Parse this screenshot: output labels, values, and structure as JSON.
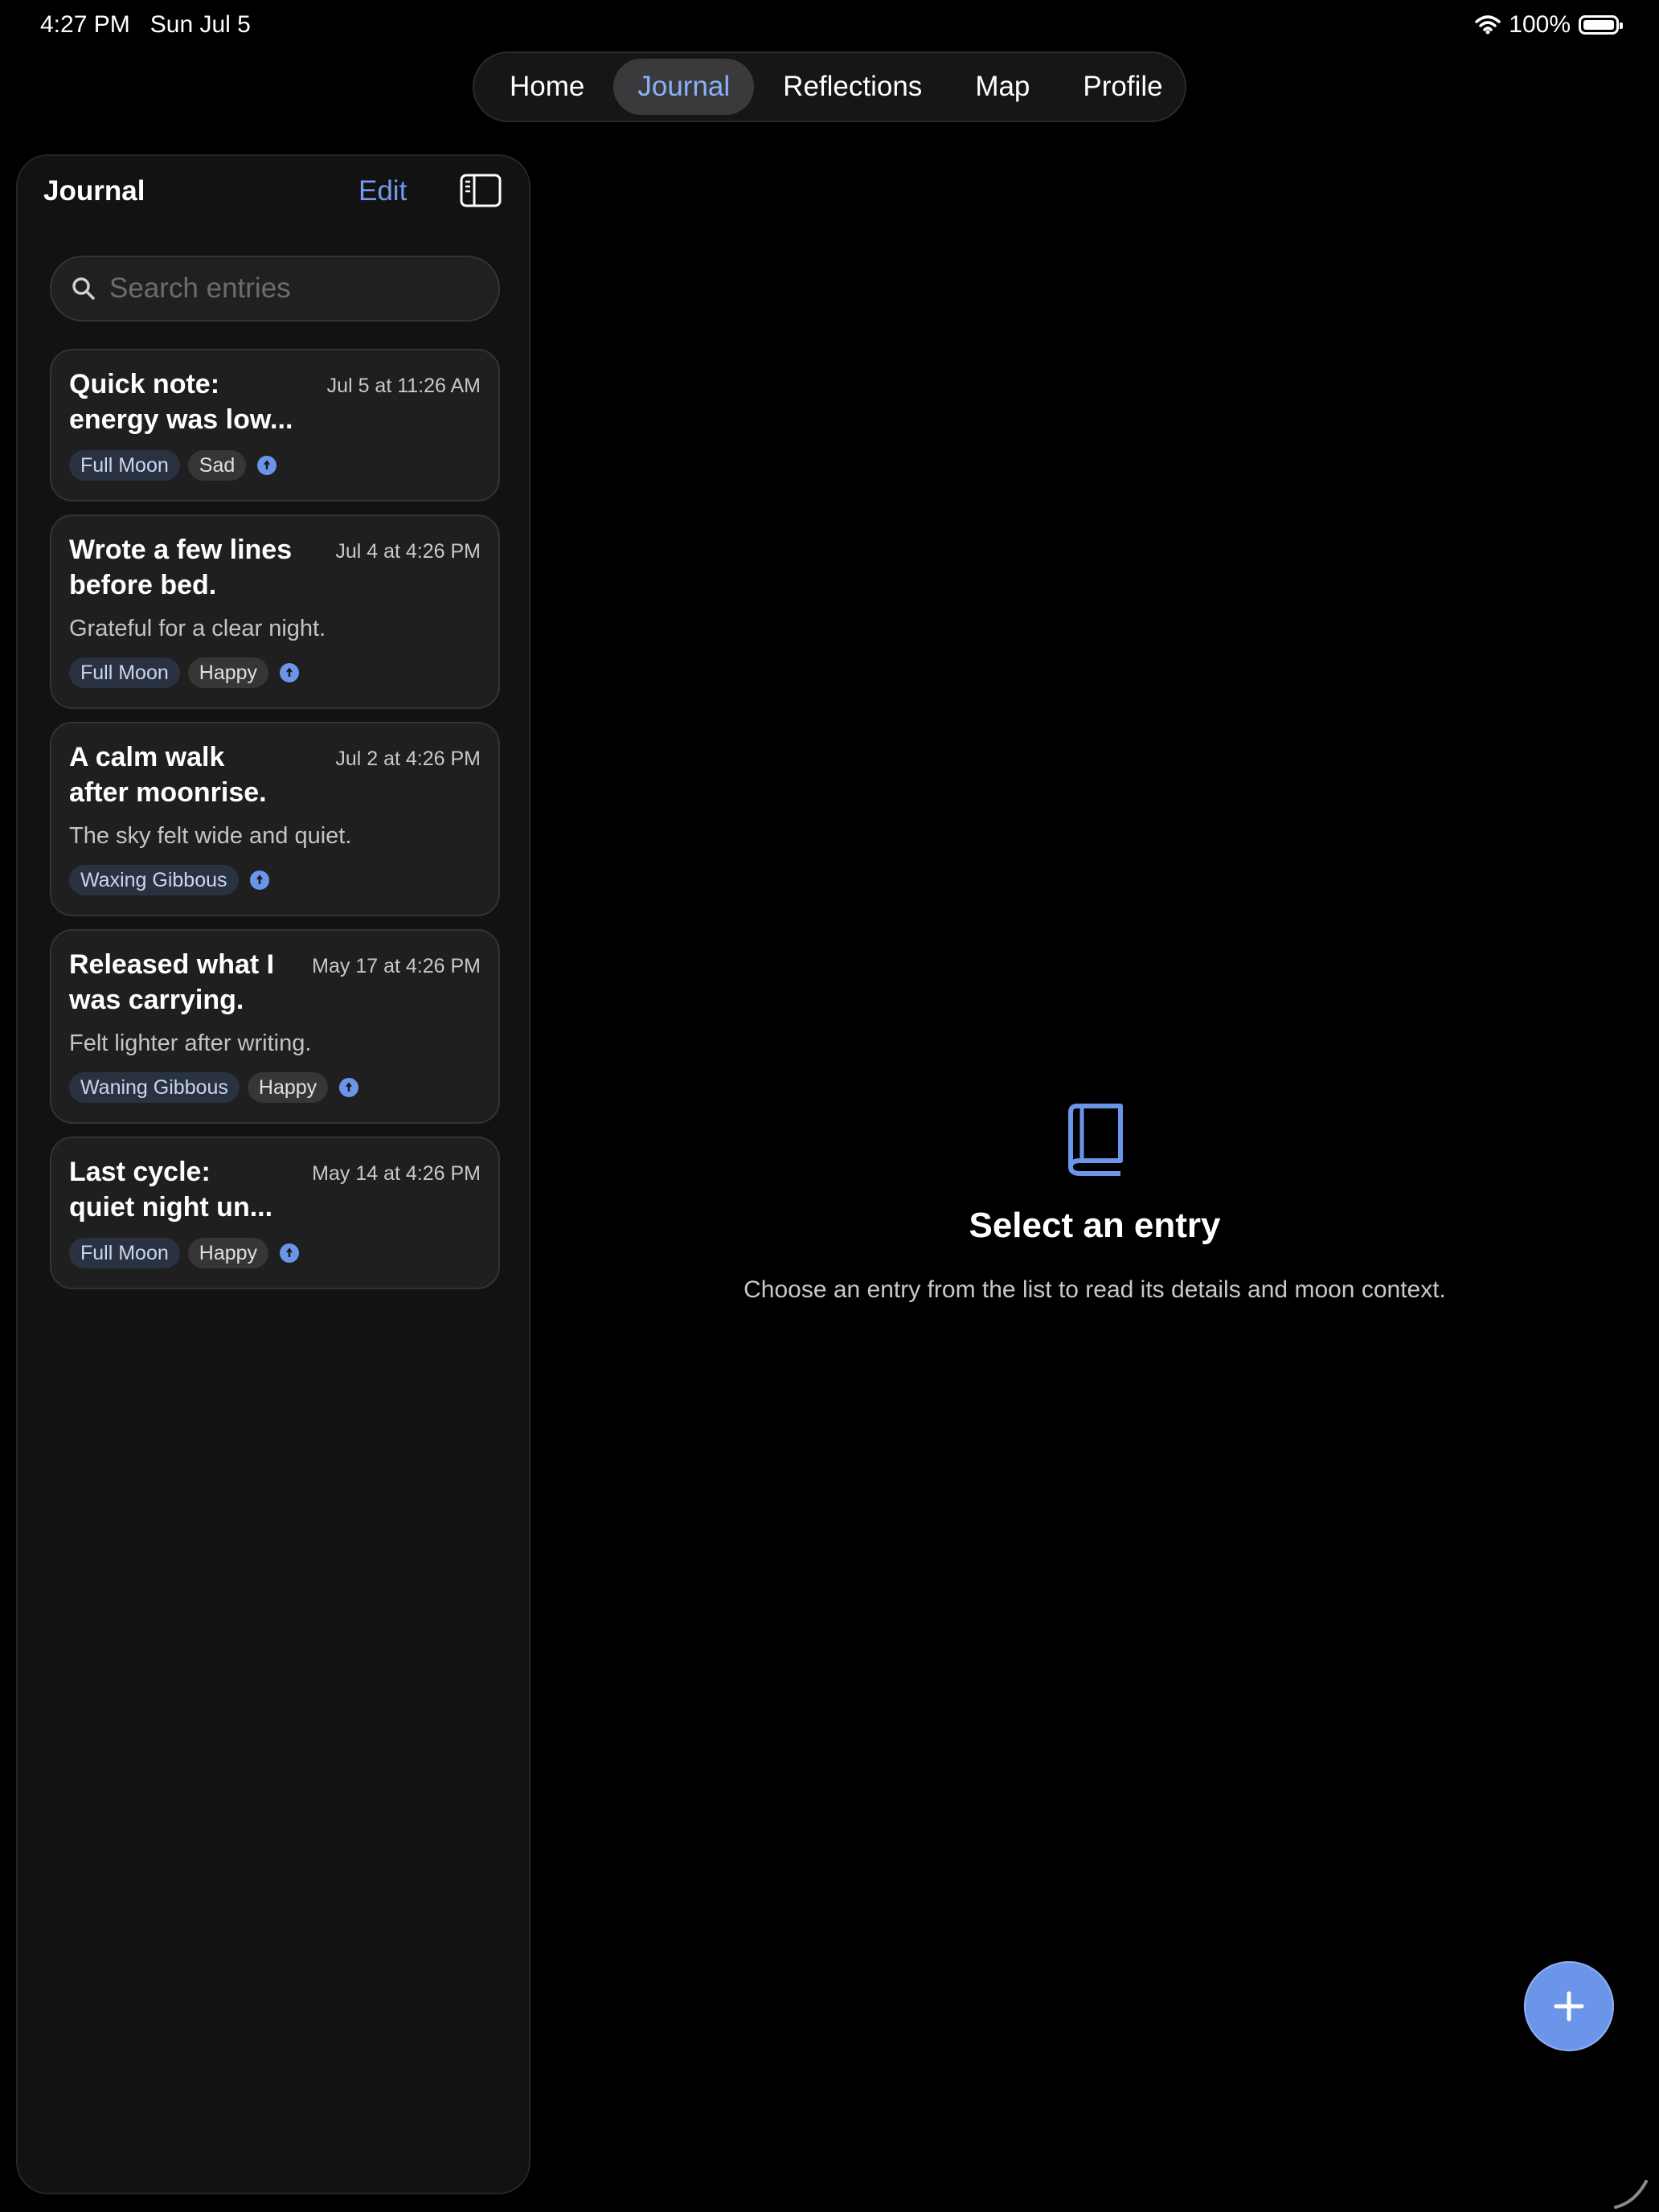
{
  "status": {
    "time": "4:27 PM",
    "date": "Sun Jul 5",
    "battery": "100%"
  },
  "nav": {
    "tabs": [
      "Home",
      "Journal",
      "Reflections",
      "Map",
      "Profile"
    ],
    "active": "Journal"
  },
  "sidebar": {
    "title": "Journal",
    "edit_label": "Edit",
    "search_placeholder": "Search entries",
    "entries": [
      {
        "title_line1": "Quick note:",
        "title_line2": "energy was low...",
        "date": "Jul 5 at 11:26 AM",
        "preview": "",
        "moon": "Full Moon",
        "mood": "Sad"
      },
      {
        "title_line1": "Wrote a few lines",
        "title_line2": "before bed.",
        "date": "Jul 4 at 4:26 PM",
        "preview": "Grateful for a clear night.",
        "moon": "Full Moon",
        "mood": "Happy"
      },
      {
        "title_line1": "A calm walk",
        "title_line2": "after moonrise.",
        "date": "Jul 2 at 4:26 PM",
        "preview": "The sky felt wide and quiet.",
        "moon": "Waxing Gibbous",
        "mood": ""
      },
      {
        "title_line1": "Released what I",
        "title_line2": "was carrying.",
        "date": "May 17 at 4:26 PM",
        "preview": "Felt lighter after writing.",
        "moon": "Waning Gibbous",
        "mood": "Happy"
      },
      {
        "title_line1": "Last cycle:",
        "title_line2": "quiet night un...",
        "date": "May 14 at 4:26 PM",
        "preview": "",
        "moon": "Full Moon",
        "mood": "Happy"
      }
    ]
  },
  "empty_state": {
    "icon": "book-icon",
    "title": "Select an entry",
    "subtitle": "Choose an entry from the list to read its details and moon context."
  },
  "colors": {
    "accent": "#6a95e8",
    "active_tab_text": "#8cb0f5",
    "background": "#000000"
  }
}
